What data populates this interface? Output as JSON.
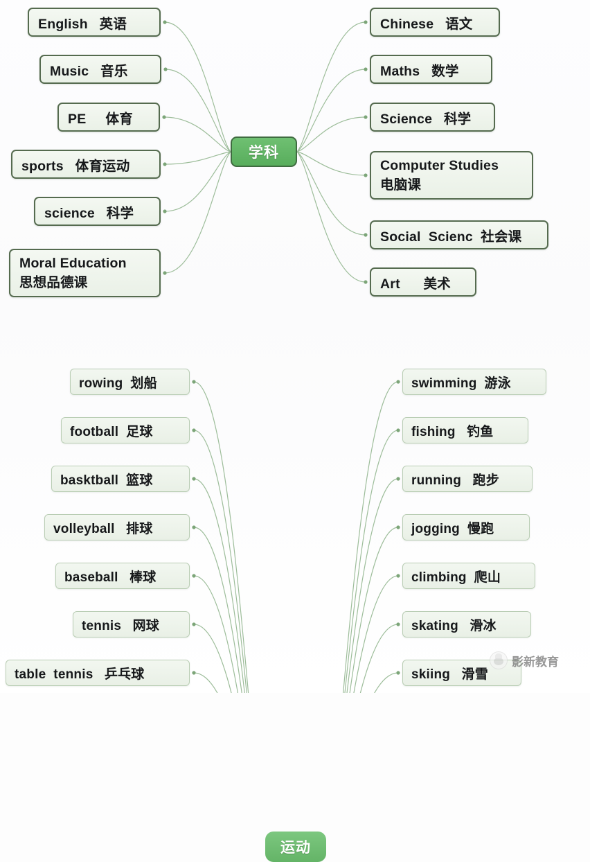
{
  "palette": {
    "page_background": "#fdfdfd",
    "node_fill": "#f0f5ee",
    "node_border_top": "#556b4f",
    "node_border_bottom": "#b9cdb4",
    "root_fill": "#62b466",
    "root_text": "#ffffff",
    "connector_line": "#9dbd9a",
    "connector_dot": "#7ca578",
    "text": "#16181a"
  },
  "maps": [
    {
      "id": "subjects",
      "root": {
        "label": "学科"
      },
      "left_nodes": [
        {
          "english": "English",
          "chinese": "英语",
          "label": "English   英语"
        },
        {
          "english": "Music",
          "chinese": "音乐",
          "label": "Music   音乐"
        },
        {
          "english": "PE",
          "chinese": "体育",
          "label": "PE     体育"
        },
        {
          "english": "sports",
          "chinese": "体育运动",
          "label": "sports   体育运动"
        },
        {
          "english": "science",
          "chinese": "科学",
          "label": "science   科学"
        },
        {
          "english": "Moral Education",
          "chinese": "思想品德课",
          "label": "Moral Education",
          "label2": "思想品德课"
        }
      ],
      "right_nodes": [
        {
          "english": "Chinese",
          "chinese": "语文",
          "label": "Chinese   语文"
        },
        {
          "english": "Maths",
          "chinese": "数学",
          "label": "Maths   数学"
        },
        {
          "english": "Science",
          "chinese": "科学",
          "label": "Science   科学"
        },
        {
          "english": "Computer Studies",
          "chinese": "电脑课",
          "label": "Computer Studies",
          "label2": "电脑课"
        },
        {
          "english": "Social Scienc",
          "chinese": "社会课",
          "label": "Social  Scienc  社会课"
        },
        {
          "english": "Art",
          "chinese": "美术",
          "label": "Art      美术"
        }
      ]
    },
    {
      "id": "sports",
      "root": {
        "label": "运动"
      },
      "left_nodes": [
        {
          "english": "rowing",
          "chinese": "划船",
          "label": "rowing  划船"
        },
        {
          "english": "football",
          "chinese": "足球",
          "label": "football  足球"
        },
        {
          "english": "basktball",
          "chinese": "篮球",
          "label": "basktball  篮球"
        },
        {
          "english": "volleyball",
          "chinese": "排球",
          "label": "volleyball   排球"
        },
        {
          "english": "baseball",
          "chinese": "棒球",
          "label": "baseball   棒球"
        },
        {
          "english": "tennis",
          "chinese": "网球",
          "label": "tennis   网球"
        },
        {
          "english": "table tennis",
          "chinese": "乒乓球",
          "label": "table  tennis   乒乓球"
        }
      ],
      "right_nodes": [
        {
          "english": "swimming",
          "chinese": "游泳",
          "label": "swimming  游泳"
        },
        {
          "english": "fishing",
          "chinese": "钓鱼",
          "label": "fishing   钓鱼"
        },
        {
          "english": "running",
          "chinese": "跑步",
          "label": "running   跑步"
        },
        {
          "english": "jogging",
          "chinese": "慢跑",
          "label": "jogging  慢跑"
        },
        {
          "english": "climbing",
          "chinese": "爬山",
          "label": "climbing  爬山"
        },
        {
          "english": "skating",
          "chinese": "滑冰",
          "label": "skating   滑冰"
        },
        {
          "english": "skiing",
          "chinese": "滑雪",
          "label": "skiing   滑雪"
        }
      ]
    }
  ],
  "watermark": {
    "text": "影新教育",
    "logo": "account-avatar-icon"
  }
}
